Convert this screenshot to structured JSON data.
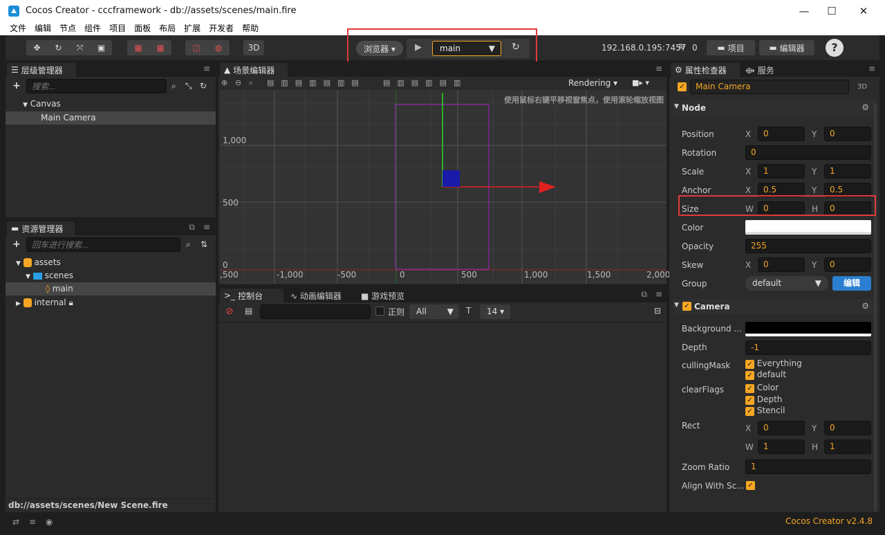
{
  "window": {
    "title": "Cocos Creator - cccframework - db://assets/scenes/main.fire",
    "minimize": "—",
    "maximize": "☐",
    "close": "✕"
  },
  "menu": [
    "文件",
    "编辑",
    "节点",
    "组件",
    "项目",
    "面板",
    "布局",
    "扩展",
    "开发者",
    "帮助"
  ],
  "toolbar": {
    "mode3d": "3D",
    "browser": "浏览器 ▾",
    "play": "▶",
    "scene_select": "main",
    "refresh": "↻",
    "ip": "192.168.0.195:7457",
    "wifi_count": "0",
    "project_btn": "项目",
    "editor_btn": "编辑器",
    "help": "?"
  },
  "hierarchy": {
    "title": "层级管理器",
    "search_placeholder": "搜索...",
    "items": [
      {
        "label": "Canvas"
      },
      {
        "label": "Main Camera"
      }
    ]
  },
  "assets": {
    "title": "资源管理器",
    "search_placeholder": "回车进行搜索...",
    "items": [
      {
        "label": "assets"
      },
      {
        "label": "scenes"
      },
      {
        "label": "main"
      },
      {
        "label": "internal"
      }
    ],
    "path": "db://assets/scenes/New Scene.fire"
  },
  "scene": {
    "title": "场景编辑器",
    "rendering": "Rendering",
    "hint": "使用鼠标右键平移视窗焦点，使用滚轮缩放视图",
    "y_labels": [
      "1,000",
      "500",
      "0"
    ],
    "x_labels": [
      ",500",
      "-1,000",
      "-500",
      "0",
      "500",
      "1,000",
      "1,500",
      "2,000"
    ]
  },
  "console": {
    "tabs": [
      "控制台",
      "动画编辑器",
      "游戏预览"
    ],
    "regex": "正则",
    "level": "All",
    "font_size": "14"
  },
  "inspector": {
    "tabs": [
      "属性检查器",
      "服务"
    ],
    "node_name": "Main Camera",
    "badge3d": "3D",
    "node_section": "Node",
    "props": [
      {
        "label": "Position",
        "a": "X",
        "av": "0",
        "b": "Y",
        "bv": "0"
      },
      {
        "label": "Rotation",
        "single": "0"
      },
      {
        "label": "Scale",
        "a": "X",
        "av": "1",
        "b": "Y",
        "bv": "1"
      },
      {
        "label": "Anchor",
        "a": "X",
        "av": "0.5",
        "b": "Y",
        "bv": "0.5"
      },
      {
        "label": "Size",
        "a": "W",
        "av": "0",
        "b": "H",
        "bv": "0"
      },
      {
        "label": "Color"
      },
      {
        "label": "Opacity",
        "single": "255"
      },
      {
        "label": "Skew",
        "a": "X",
        "av": "0",
        "b": "Y",
        "bv": "0"
      },
      {
        "label": "Group",
        "group": "default",
        "edit": "编辑"
      }
    ],
    "camera_section": "Camera",
    "camera": {
      "background": "Background ...",
      "depth_label": "Depth",
      "depth": "-1",
      "culling_label": "cullingMask",
      "culling": [
        "Everything",
        "default"
      ],
      "clear_label": "clearFlags",
      "clear": [
        "Color",
        "Depth",
        "Stencil"
      ],
      "rect_label": "Rect",
      "rect": {
        "x": "0",
        "y": "0",
        "w": "1",
        "h": "1"
      },
      "zoom_label": "Zoom Ratio",
      "zoom": "1",
      "align_label": "Align With Sc..."
    }
  },
  "footer": {
    "version": "Cocos Creator v2.4.8"
  },
  "colors": {
    "accent": "#f5a623",
    "highlight": "#e03a3a"
  }
}
